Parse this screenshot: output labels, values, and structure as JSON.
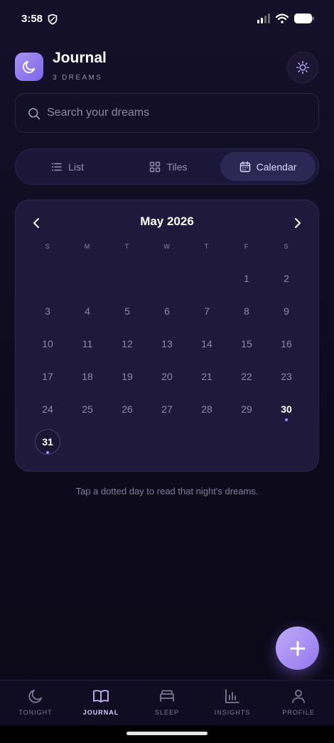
{
  "status": {
    "time": "3:58"
  },
  "header": {
    "title": "Journal",
    "subtitle": "3 DREAMS"
  },
  "search": {
    "placeholder": "Search your dreams",
    "value": ""
  },
  "view_tabs": [
    {
      "label": "List",
      "icon": "list-icon",
      "active": false
    },
    {
      "label": "Tiles",
      "icon": "grid-icon",
      "active": false
    },
    {
      "label": "Calendar",
      "icon": "calendar-icon",
      "active": true
    }
  ],
  "calendar": {
    "month_label": "May 2026",
    "weekdays": [
      "S",
      "M",
      "T",
      "W",
      "T",
      "F",
      "S"
    ],
    "leading_blanks": 5,
    "days": [
      1,
      2,
      3,
      4,
      5,
      6,
      7,
      8,
      9,
      10,
      11,
      12,
      13,
      14,
      15,
      16,
      17,
      18,
      19,
      20,
      21,
      22,
      23,
      24,
      25,
      26,
      27,
      28,
      29,
      30,
      31
    ],
    "dream_days": [
      30,
      31
    ],
    "today": 31
  },
  "hint": "Tap a dotted day to read that night's dreams.",
  "bottom_nav": [
    {
      "label": "TONIGHT",
      "icon": "moon-icon",
      "active": false
    },
    {
      "label": "JOURNAL",
      "icon": "book-icon",
      "active": true
    },
    {
      "label": "SLEEP",
      "icon": "bed-icon",
      "active": false
    },
    {
      "label": "INSIGHTS",
      "icon": "bar-chart-icon",
      "active": false
    },
    {
      "label": "PROFILE",
      "icon": "user-icon",
      "active": false
    }
  ],
  "colors": {
    "accent": "#a48cf5",
    "background": "#0e0b1f",
    "card": "#1f1a3c"
  }
}
